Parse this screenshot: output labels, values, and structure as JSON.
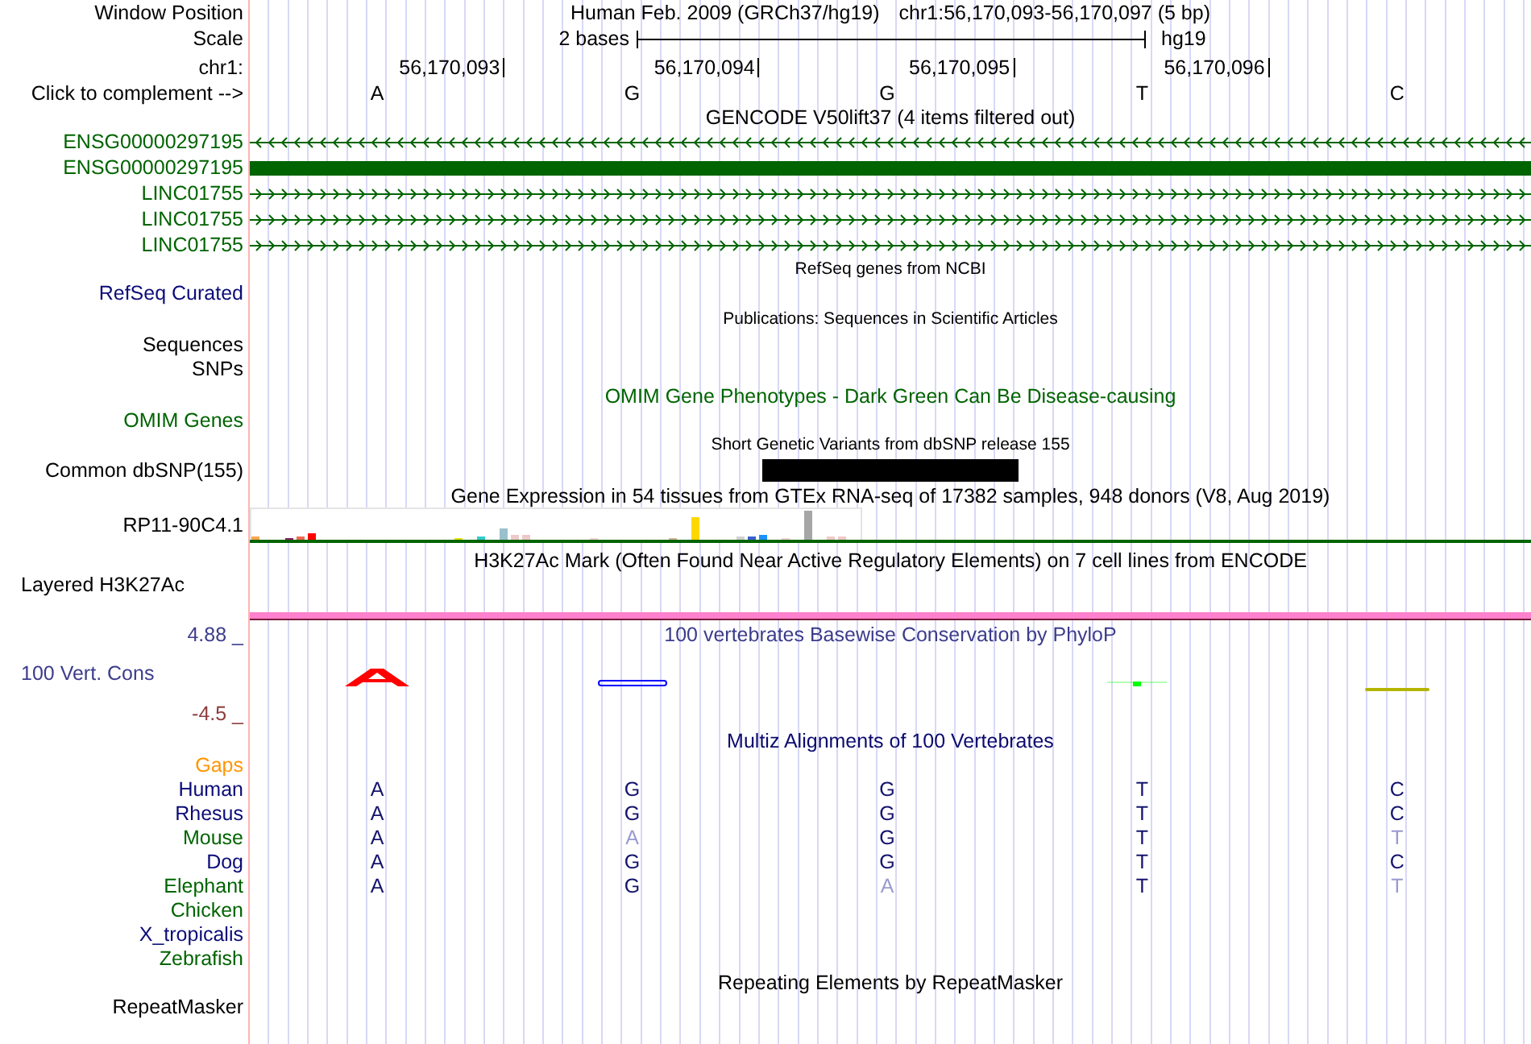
{
  "header": {
    "window_position": {
      "label": "Window Position",
      "assembly": "Human Feb. 2009 (GRCh37/hg19)",
      "range": "chr1:56,170,093-56,170,097 (5 bp)"
    },
    "scale": {
      "label": "Scale",
      "span": "2 bases",
      "assembly": "hg19"
    },
    "ruler": {
      "label": "chr1:",
      "ticks": [
        "56,170,093",
        "56,170,094",
        "56,170,095",
        "56,170,096"
      ]
    },
    "sequence": {
      "label": "Click to complement -->",
      "bases": [
        "A",
        "G",
        "G",
        "T",
        "C"
      ]
    }
  },
  "tracks": [
    {
      "kind": "genes",
      "title": {
        "text": "GENCODE V50lift37 (4 items filtered out)",
        "color": "#000000"
      },
      "color": "#006400",
      "items": [
        {
          "label": "ENSG00000297195",
          "kind": "reverse"
        },
        {
          "label": "ENSG00000297195",
          "kind": "block"
        },
        {
          "label": "LINC01755",
          "kind": "forward"
        },
        {
          "label": "LINC01755",
          "kind": "forward"
        },
        {
          "label": "LINC01755",
          "kind": "forward"
        }
      ]
    },
    {
      "kind": "refseq",
      "title": {
        "text": "RefSeq genes from NCBI",
        "color": "#000000"
      },
      "labels": [
        {
          "text": "RefSeq Curated",
          "color": "#0c0c78"
        }
      ]
    },
    {
      "kind": "publications",
      "title": {
        "text": "Publications: Sequences in Scientific Articles",
        "color": "#000000"
      },
      "labels": [
        {
          "text": "Sequences",
          "color": "#000000"
        },
        {
          "text": "SNPs",
          "color": "#000000"
        }
      ]
    },
    {
      "kind": "omim",
      "title": {
        "text": "OMIM Gene Phenotypes - Dark Green Can Be Disease-causing",
        "color": "#006400"
      },
      "labels": [
        {
          "text": "OMIM Genes",
          "color": "#006400"
        }
      ]
    },
    {
      "kind": "dbsnp",
      "title": {
        "text": "Short Genetic Variants from dbSNP release 155",
        "color": "#000000"
      },
      "labels": [
        {
          "text": "Common dbSNP(155)",
          "color": "#000000"
        }
      ]
    },
    {
      "kind": "gtex",
      "title": {
        "text": "Gene Expression in 54 tissues from GTEx RNA-seq of 17382 samples, 948 donors (V8, Aug 2019)",
        "color": "#000000"
      },
      "labels": [
        {
          "text": "RP11-90C4.1",
          "color": "#000000"
        }
      ]
    },
    {
      "kind": "h3k27ac",
      "title": {
        "text": "H3K27Ac Mark (Often Found Near Active Regulatory Elements) on 7 cell lines from ENCODE",
        "color": "#000000"
      },
      "labels": [
        {
          "text": "Layered H3K27Ac",
          "color": "#000000"
        }
      ]
    },
    {
      "kind": "phylop",
      "title": {
        "text": "100 vertebrates Basewise Conservation by PhyloP",
        "color": "#3c3c8c"
      },
      "labels": [
        {
          "text": "100 Vert. Cons",
          "color": "#3c3c8c"
        }
      ],
      "max": {
        "text": "4.88 _",
        "color": "#3c3c8c"
      },
      "min": {
        "text": "-4.5 _",
        "color": "#8c3c3c"
      },
      "glyphs": [
        {
          "color": "#ff0000"
        },
        {
          "color": "#0000ff"
        },
        {
          "color": "#00ff00"
        },
        {
          "color": "#b4b400"
        }
      ]
    },
    {
      "kind": "multiz",
      "title": {
        "text": "Multiz Alignments of 100 Vertebrates",
        "color": "#0a0a6e"
      },
      "gaps": {
        "text": "Gaps",
        "color": "#ff9600"
      },
      "species": [
        {
          "name": "Human",
          "color": "#0c0c78",
          "bases": [
            {
              "base": "A",
              "mismatch": false
            },
            {
              "base": "G",
              "mismatch": false
            },
            {
              "base": "G",
              "mismatch": false
            },
            {
              "base": "T",
              "mismatch": false
            },
            {
              "base": "C",
              "mismatch": false
            }
          ]
        },
        {
          "name": "Rhesus",
          "color": "#0c0c78",
          "bases": [
            {
              "base": "A",
              "mismatch": false
            },
            {
              "base": "G",
              "mismatch": false
            },
            {
              "base": "G",
              "mismatch": false
            },
            {
              "base": "T",
              "mismatch": false
            },
            {
              "base": "C",
              "mismatch": false
            }
          ]
        },
        {
          "name": "Mouse",
          "color": "#006400",
          "bases": [
            {
              "base": "A",
              "mismatch": false
            },
            {
              "base": "A",
              "mismatch": true
            },
            {
              "base": "G",
              "mismatch": false
            },
            {
              "base": "T",
              "mismatch": false
            },
            {
              "base": "T",
              "mismatch": true
            }
          ]
        },
        {
          "name": "Dog",
          "color": "#0c0c78",
          "bases": [
            {
              "base": "A",
              "mismatch": false
            },
            {
              "base": "G",
              "mismatch": false
            },
            {
              "base": "G",
              "mismatch": false
            },
            {
              "base": "T",
              "mismatch": false
            },
            {
              "base": "C",
              "mismatch": false
            }
          ]
        },
        {
          "name": "Elephant",
          "color": "#006400",
          "bases": [
            {
              "base": "A",
              "mismatch": false
            },
            {
              "base": "G",
              "mismatch": false
            },
            {
              "base": "A",
              "mismatch": true
            },
            {
              "base": "T",
              "mismatch": false
            },
            {
              "base": "T",
              "mismatch": true
            }
          ]
        },
        {
          "name": "Chicken",
          "color": "#006400"
        },
        {
          "name": "X_tropicalis",
          "color": "#0c0c78"
        },
        {
          "name": "Zebrafish",
          "color": "#006400"
        }
      ]
    },
    {
      "kind": "rmsk",
      "title": {
        "text": "Repeating Elements by RepeatMasker",
        "color": "#000000"
      },
      "labels": [
        {
          "text": "RepeatMasker",
          "color": "#000000"
        }
      ]
    }
  ]
}
